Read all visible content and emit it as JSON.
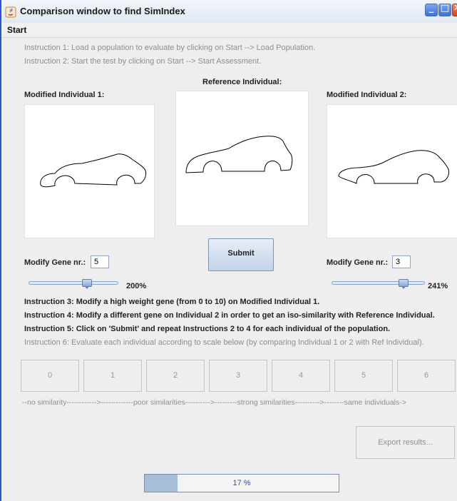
{
  "window": {
    "title": "Comparison window to find SimIndex",
    "buttons": {
      "minimize": "minimize",
      "maximize": "maximize",
      "close": "close"
    }
  },
  "menubar": {
    "start": "Start"
  },
  "instructions": {
    "i1": "Instruction 1: Load a population to evaluate by clicking on Start --> Load Population.",
    "i2": "Instruction 2: Start the test by clicking on Start --> Start Assessment.",
    "i3": "Instruction 3: Modify a high weight gene (from 0 to 10) on Modified Individual 1.",
    "i4": "Instruction 4: Modify a different gene on Individual 2 in order to get an iso-similarity with Reference Individual.",
    "i5": "Instruction 5: Click on 'Submit' and repeat Instructions 2 to 4 for each individual of the population.",
    "i6": "Instruction 6: Evaluate each individual according to scale below (by comparing Individual 1 or 2 with Ref Individual)."
  },
  "panels": {
    "modified1_label": "Modified Individual 1:",
    "reference_label": "Reference Individual:",
    "modified2_label": "Modified Individual 2:"
  },
  "controls": {
    "gene1_label": "Modify Gene nr.:",
    "gene1_value": "5",
    "gene2_label": "Modify Gene nr.:",
    "gene2_value": "3",
    "slider1_percent": "200%",
    "slider1_fraction": 0.67,
    "slider2_percent": "241%",
    "slider2_fraction": 0.8,
    "submit_label": "Submit"
  },
  "scale": {
    "buttons": [
      "0",
      "1",
      "2",
      "3",
      "4",
      "5",
      "6"
    ],
    "legend": "--no similarity------------>-------------poor similarities---------->---------strong similarities---------->--------same individuals->"
  },
  "export_label": "Export results...",
  "progress": {
    "label": "17 %",
    "fraction": 0.17
  }
}
